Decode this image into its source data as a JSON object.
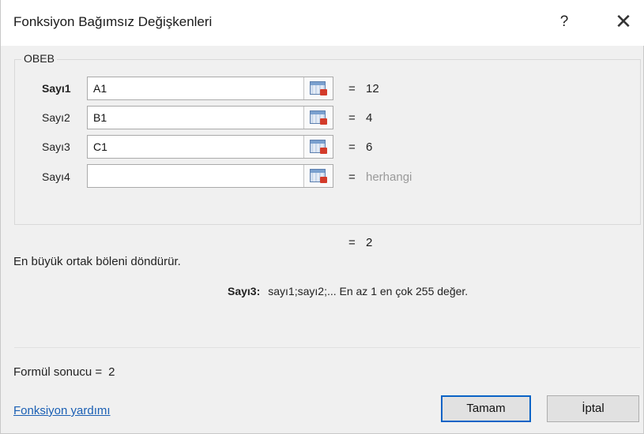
{
  "window": {
    "title": "Fonksiyon Bağımsız Değişkenleri",
    "help_glyph": "?",
    "close_glyph": "✕"
  },
  "function_group": {
    "name": "OBEB",
    "args": [
      {
        "label": "Sayı1",
        "value": "A1",
        "equals": "=",
        "result": "12"
      },
      {
        "label": "Sayı2",
        "value": "B1",
        "equals": "=",
        "result": "4"
      },
      {
        "label": "Sayı3",
        "value": "C1",
        "equals": "=",
        "result": "6"
      },
      {
        "label": "Sayı4",
        "value": "",
        "equals": "=",
        "result": "herhangi"
      }
    ],
    "ref_icon": "collapse-dialog-icon"
  },
  "overall": {
    "equals": "=",
    "result": "2"
  },
  "description": "En büyük ortak böleni döndürür.",
  "arg_description": {
    "name": "Sayı3:",
    "text": "sayı1;sayı2;... En az 1 en çok 255 değer."
  },
  "formula_result": {
    "label": "Formül sonucu =",
    "value": "2"
  },
  "help_link": "Fonksiyon yardımı",
  "buttons": {
    "ok": "Tamam",
    "cancel": "İptal"
  },
  "colors": {
    "accent": "#0a63c6",
    "link": "#1a5fb4",
    "placeholder_result": "#9a9a9a"
  }
}
